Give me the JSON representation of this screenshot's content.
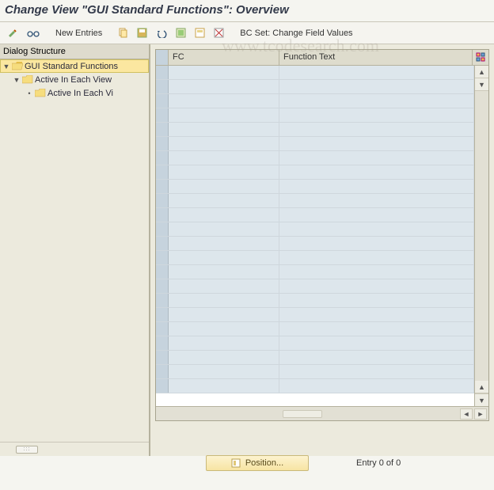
{
  "title": "Change View \"GUI Standard Functions\": Overview",
  "toolbar": {
    "new_entries": "New Entries",
    "bcset": "BC Set: Change Field Values"
  },
  "tree": {
    "header": "Dialog Structure",
    "nodes": [
      {
        "label": "GUI Standard Functions",
        "indent": 0,
        "selected": true,
        "open": true
      },
      {
        "label": "Active In Each View",
        "indent": 1,
        "selected": false,
        "open": true
      },
      {
        "label": "Active In Each Vi",
        "indent": 2,
        "selected": false,
        "open": false
      }
    ]
  },
  "table": {
    "columns": {
      "fc": "FC",
      "ftext": "Function Text"
    },
    "rows": []
  },
  "footer": {
    "position_label": "Position...",
    "entry_text": "Entry 0 of 0"
  },
  "watermark": "www.tcodesearch.com"
}
